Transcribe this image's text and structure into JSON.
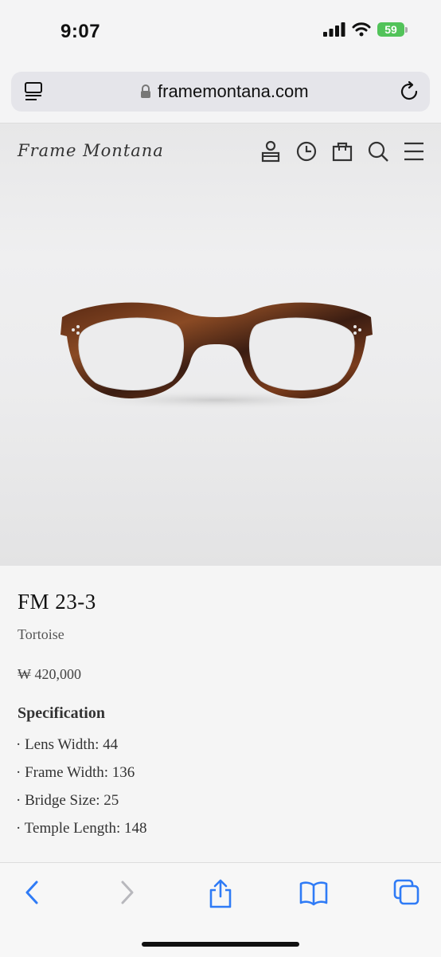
{
  "status": {
    "time": "9:07",
    "battery": "59"
  },
  "browser": {
    "url": "framemontana.com"
  },
  "site": {
    "logo": "Frame Montana"
  },
  "product": {
    "name": "FM 23-3",
    "color": "Tortoise",
    "price": "₩ 420,000",
    "spec_title": "Specification",
    "specs": [
      "· Lens Width: 44",
      "· Frame Width: 136",
      "· Bridge Size: 25",
      "· Temple Length: 148"
    ]
  },
  "icons": {
    "nav": [
      "account-icon",
      "history-icon",
      "bag-icon",
      "search-icon",
      "menu-icon"
    ],
    "toolbar": [
      "back-icon",
      "forward-icon",
      "share-icon",
      "bookmarks-icon",
      "tabs-icon"
    ]
  },
  "colors": {
    "accent": "#2f7bf6",
    "battery": "#52c35a",
    "tortoise_dark": "#3b1d12",
    "tortoise_light": "#8a4a24"
  }
}
